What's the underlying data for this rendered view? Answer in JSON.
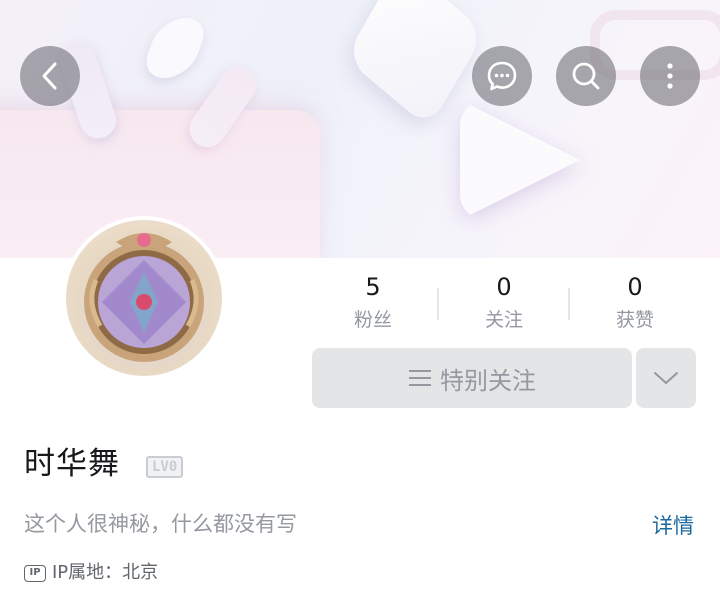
{
  "header": {
    "icons": [
      "back-icon",
      "chat-icon",
      "search-icon",
      "more-icon"
    ]
  },
  "stats": {
    "fans": {
      "value": "5",
      "label": "粉丝"
    },
    "following": {
      "value": "0",
      "label": "关注"
    },
    "likes": {
      "value": "0",
      "label": "获赞"
    }
  },
  "follow": {
    "label": "特别关注"
  },
  "profile": {
    "name": "时华舞",
    "level": "LV0",
    "bio": "这个人很神秘，什么都没有写",
    "detail_link": "详情",
    "ip_label": "IP属地：北京",
    "ip_badge": "IP"
  },
  "colors": {
    "link": "#1a6aa0",
    "muted": "#9499a0",
    "button_bg": "#e3e5e7"
  }
}
